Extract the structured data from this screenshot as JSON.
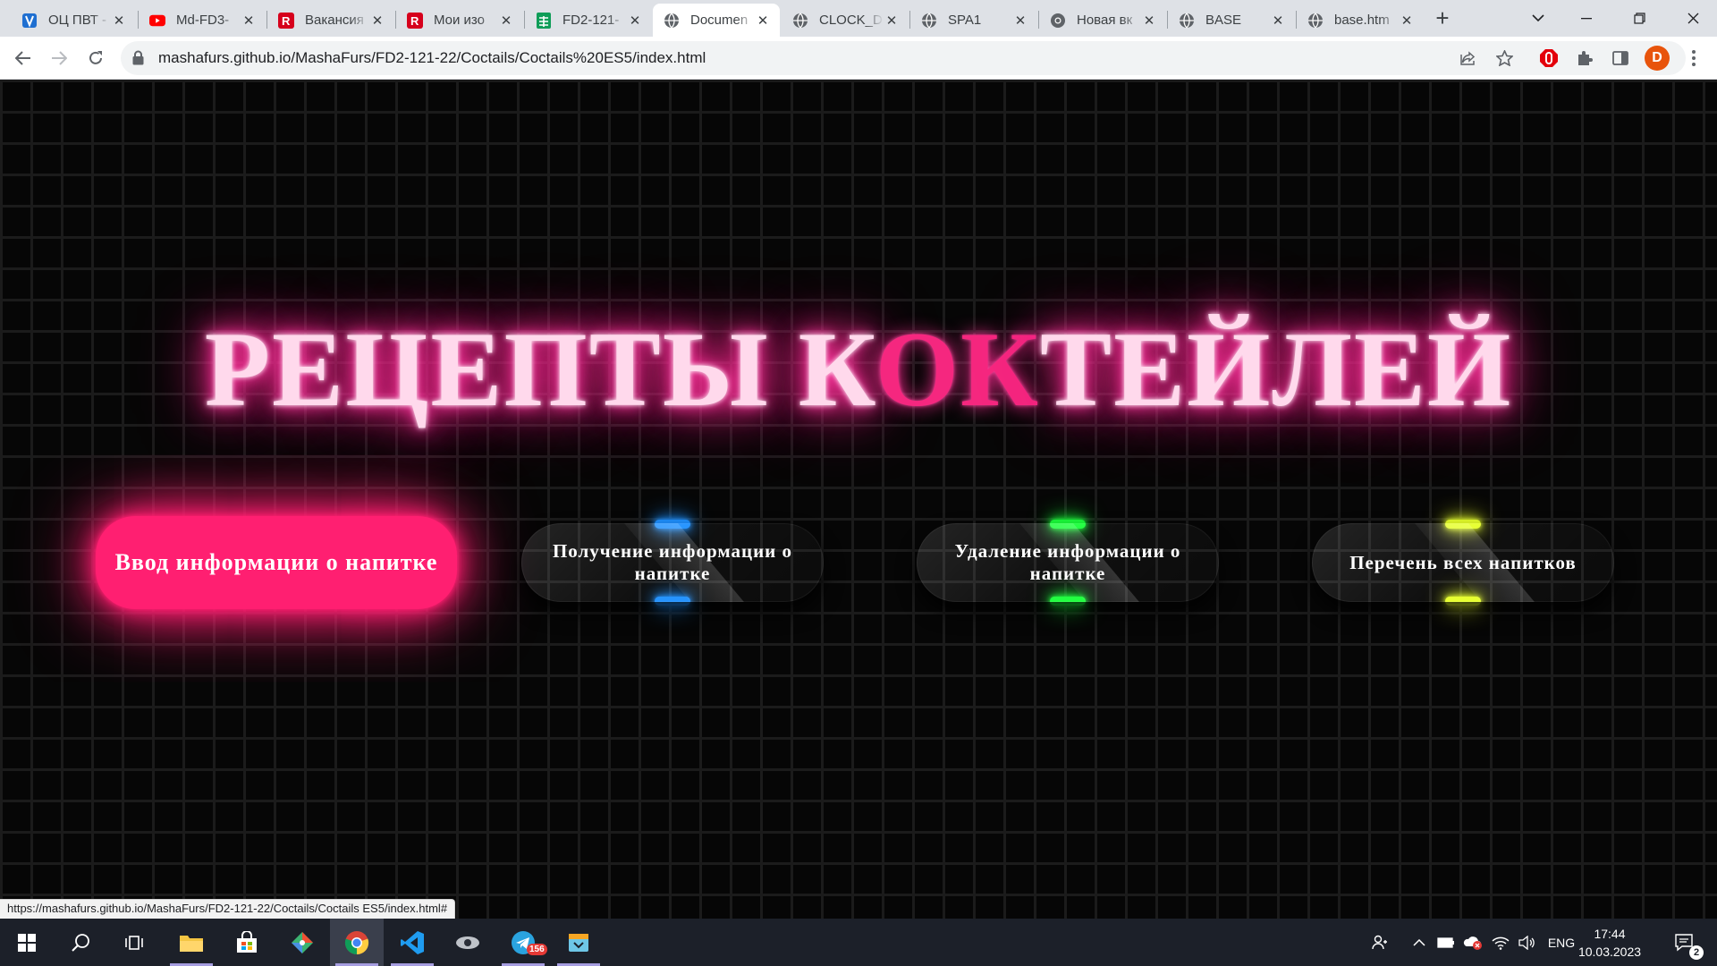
{
  "browser": {
    "tabs": [
      {
        "title": "ОЦ ПВТ -",
        "icon": "ocpvt-favicon"
      },
      {
        "title": "Md-FD3-",
        "icon": "youtube-favicon"
      },
      {
        "title": "Вакансия",
        "icon": "rabota-favicon"
      },
      {
        "title": "Мои изо",
        "icon": "rabota-favicon"
      },
      {
        "title": "FD2-121-",
        "icon": "sheets-favicon"
      },
      {
        "title": "Documen",
        "icon": "globe-favicon",
        "active": true
      },
      {
        "title": "CLOCK_D",
        "icon": "globe-favicon"
      },
      {
        "title": "SPA1",
        "icon": "globe-favicon"
      },
      {
        "title": "Новая вк",
        "icon": "chrome-favicon"
      },
      {
        "title": "BASE",
        "icon": "globe-favicon"
      },
      {
        "title": "base.htm",
        "icon": "globe-favicon"
      }
    ],
    "url": "mashafurs.github.io/MashaFurs/FD2-121-22/Coctails/Coctails%20ES5/index.html",
    "profile_initial": "D",
    "status_url": "https://mashafurs.github.io/MashaFurs/FD2-121-22/Coctails/Coctails ES5/index.html#"
  },
  "page": {
    "heading_before": "РЕЦЕПТЫ К",
    "heading_flicker": "ОК",
    "heading_after": "ТЕЙЛЕЙ",
    "buttons": [
      {
        "label": "Ввод информации о напитке",
        "glow": "#ff1f71"
      },
      {
        "label": "Получение информации о напитке",
        "glow": "#1e90ff"
      },
      {
        "label": "Удаление информации о напитке",
        "glow": "#1aff3a"
      },
      {
        "label": "Перечень всех напитков",
        "glow": "#e6ff2a"
      }
    ]
  },
  "taskbar": {
    "telegram_badge": "156",
    "language": "ENG",
    "time": "17:44",
    "date": "10.03.2023",
    "notifications": "2"
  }
}
